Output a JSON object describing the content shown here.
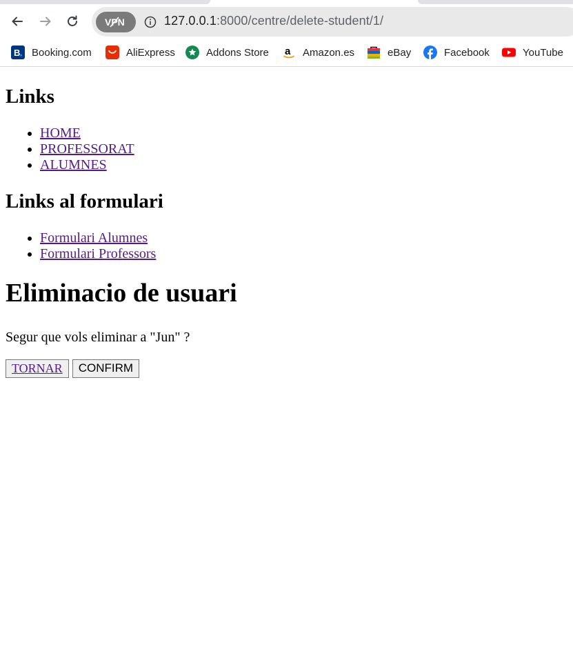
{
  "browser": {
    "url_host": "127.0.0.1",
    "url_rest": ":8000/centre/delete-student/1/",
    "vpn_label": "VPN",
    "bookmarks": [
      {
        "label": "Booking.com",
        "icon": "booking-icon",
        "color": "#003580"
      },
      {
        "label": "AliExpress",
        "icon": "aliexpress-icon",
        "color": "#e62e04"
      },
      {
        "label": "Addons Store",
        "icon": "addons-store-icon",
        "color": "#138a4f"
      },
      {
        "label": "Amazon.es",
        "icon": "amazon-icon",
        "color": "#000000"
      },
      {
        "label": "eBay",
        "icon": "ebay-icon",
        "color": "#e53238"
      },
      {
        "label": "Facebook",
        "icon": "facebook-icon",
        "color": "#1877f2"
      },
      {
        "label": "YouTube",
        "icon": "youtube-icon",
        "color": "#ff0000"
      }
    ]
  },
  "page": {
    "links_heading": "Links",
    "links": [
      "HOME",
      "PROFESSORAT",
      "ALUMNES"
    ],
    "form_links_heading": "Links al formulari",
    "form_links": [
      "Formulari Alumnes",
      "Formulari Professors"
    ],
    "title": "Eliminacio de usuari",
    "question": "Segur que vols eliminar a \"Jun\" ?",
    "back_button": "TORNAR",
    "confirm_button": "CONFIRM"
  }
}
